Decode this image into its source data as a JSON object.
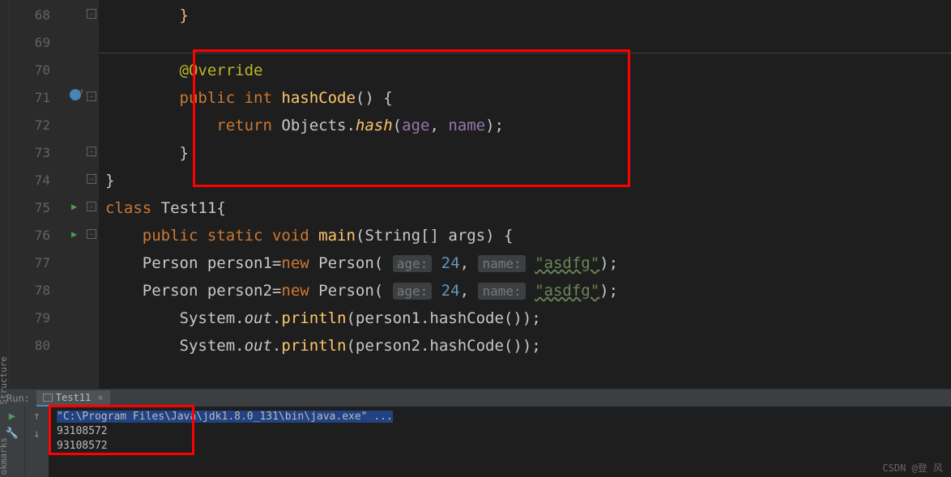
{
  "lines": {
    "68": "68",
    "69": "69",
    "70": "70",
    "71": "71",
    "72": "72",
    "73": "73",
    "74": "74",
    "75": "75",
    "76": "76",
    "77": "77",
    "78": "78",
    "79": "79",
    "80": "80"
  },
  "code": {
    "l68": "        }",
    "annotation": "@Override",
    "kw_public": "public",
    "kw_int": "int",
    "method_hashcode": "hashCode",
    "parens_empty": "() {",
    "kw_return": "return",
    "class_objects": "Objects.",
    "method_hash": "hash",
    "open_paren": "(",
    "field_age": "age",
    "comma": ", ",
    "field_name": "name",
    "close_call": ");",
    "close_brace": "}",
    "close_brace2": "}",
    "kw_class": "class",
    "class_test": "Test11",
    "open_brace": "{",
    "kw_static": "static",
    "kw_void": "void",
    "method_main": "main",
    "type_string": "String",
    "brackets": "[] ",
    "param_args": "args",
    "close_sig": ") {",
    "type_person": "Person ",
    "var_p1": "person1",
    "eq": "=",
    "kw_new": "new",
    "ctor_person": "Person",
    "hint_age": "age:",
    "num_24": "24",
    "hint_name": "name:",
    "str_asdfg": "\"asdfg\"",
    "close_ctor": ");",
    "var_p2": "person2",
    "class_system": "System.",
    "field_out": "out",
    "dot": ".",
    "method_println": "println",
    "call_hash": ".hashCode());"
  },
  "run": {
    "label": "Run:",
    "tab": "Test11",
    "cmd": "\"C:\\Program Files\\Java\\jdk1.8.0_131\\bin\\java.exe\" ...",
    "out1": "93108572",
    "out2": "93108572"
  },
  "vert": {
    "structure": "Structure",
    "bookmarks": "okmarks"
  },
  "watermark": "CSDN @登 风"
}
